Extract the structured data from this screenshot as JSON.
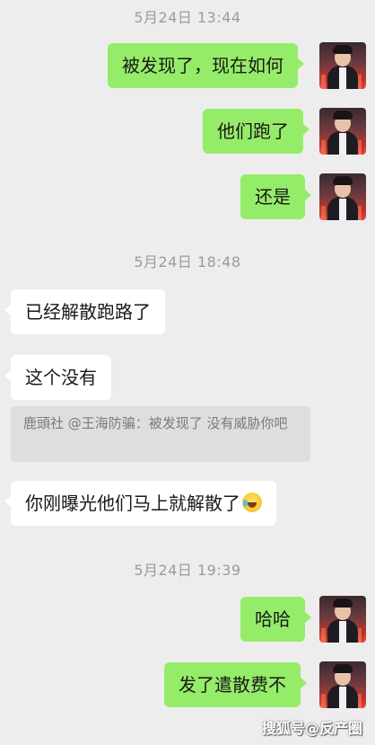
{
  "messages": [
    {
      "type": "timestamp",
      "text": "5月24日 13:44"
    },
    {
      "type": "outgoing",
      "text": "被发现了，现在如何"
    },
    {
      "type": "outgoing",
      "text": "他们跑了"
    },
    {
      "type": "outgoing",
      "text": "还是"
    },
    {
      "type": "timestamp",
      "text": "5月24日 18:48"
    },
    {
      "type": "incoming",
      "text": "已经解散跑路了"
    },
    {
      "type": "incoming",
      "text": "这个没有"
    },
    {
      "type": "quote",
      "text": "鹿頭社 @王海防骗：被发现了 没有威胁你吧"
    },
    {
      "type": "incoming",
      "text": "你刚曝光他们马上就解散了",
      "emoji": "crying-laughing-emoji"
    },
    {
      "type": "timestamp",
      "text": "5月24日 19:39"
    },
    {
      "type": "outgoing",
      "text": "哈哈"
    },
    {
      "type": "outgoing",
      "text": "发了遣散费不"
    }
  ],
  "watermark": "搜狐号@反产圈",
  "colors": {
    "background": "#ededed",
    "outgoing_bubble": "#95ec69",
    "incoming_bubble": "#ffffff",
    "quote_bg": "#dedede"
  }
}
